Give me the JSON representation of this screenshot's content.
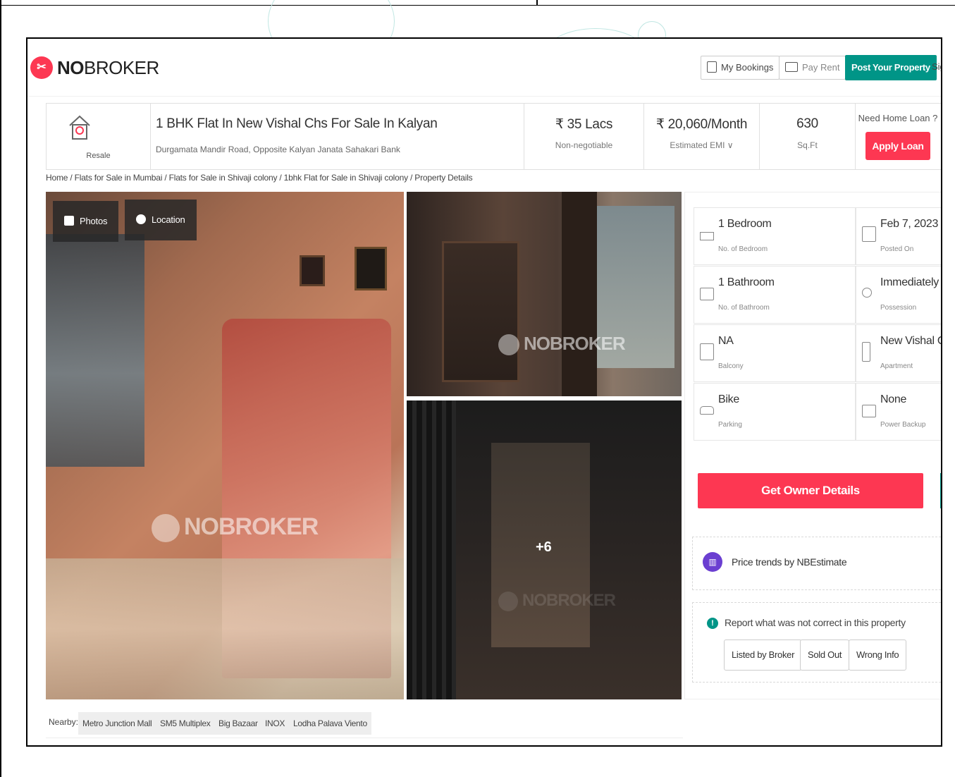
{
  "header": {
    "logo_bold": "NO",
    "logo_rest": "BROKER",
    "my_bookings": "My Bookings",
    "pay_rent": "Pay Rent",
    "post_property": "Post Your Property",
    "sign_in": "Sig"
  },
  "summary": {
    "type_label": "Resale",
    "title": "1 BHK Flat In New Vishal Chs For Sale In Kalyan",
    "address": "Durgamata Mandir Road, Opposite Kalyan Janata Sahakari Bank",
    "price": "₹ 35 Lacs",
    "price_note": "Non-negotiable",
    "emi": "₹ 20,060/Month",
    "emi_note": "Estimated EMI ∨",
    "area": "630",
    "area_unit": "Sq.Ft",
    "loan_question": "Need Home Loan ?",
    "apply_loan": "Apply Loan"
  },
  "breadcrumb": "Home / Flats for Sale in Mumbai / Flats for Sale in Shivaji colony / 1bhk Flat for Sale in Shivaji colony / Property Details",
  "gallery": {
    "photos_btn": "Photos",
    "location_btn": "Location",
    "watermark": "NOBROKER",
    "more_count": "+6"
  },
  "details": [
    {
      "value": "1 Bedroom",
      "label": "No. of Bedroom",
      "icon": "bed-icon"
    },
    {
      "value": "Feb 7, 2023",
      "label": "Posted On",
      "icon": "calendar-icon"
    },
    {
      "value": "1 Bathroom",
      "label": "No. of Bathroom",
      "icon": "bathtub-icon"
    },
    {
      "value": "Immediately",
      "label": "Possession",
      "icon": "key-icon"
    },
    {
      "value": "NA",
      "label": "Balcony",
      "icon": "balcony-icon"
    },
    {
      "value": "New Vishal Chs",
      "label": "Apartment",
      "icon": "building-icon"
    },
    {
      "value": "Bike",
      "label": "Parking",
      "icon": "car-icon"
    },
    {
      "value": "None",
      "label": "Power Backup",
      "icon": "battery-icon"
    }
  ],
  "actions": {
    "owner_details": "Get Owner Details",
    "price_trends": "Price trends by NBEstimate",
    "report_text": "Report what was not correct in this property",
    "report_options": [
      "Listed by Broker",
      "Sold Out",
      "Wrong Info"
    ]
  },
  "nearby": {
    "label": "Nearby:",
    "places": [
      "Metro Junction Mall",
      "SM5 Multiplex",
      "Big Bazaar",
      "INOX",
      "Lodha Palava Viento"
    ]
  },
  "colors": {
    "brand_red": "#fd3752",
    "brand_teal": "#009587"
  }
}
